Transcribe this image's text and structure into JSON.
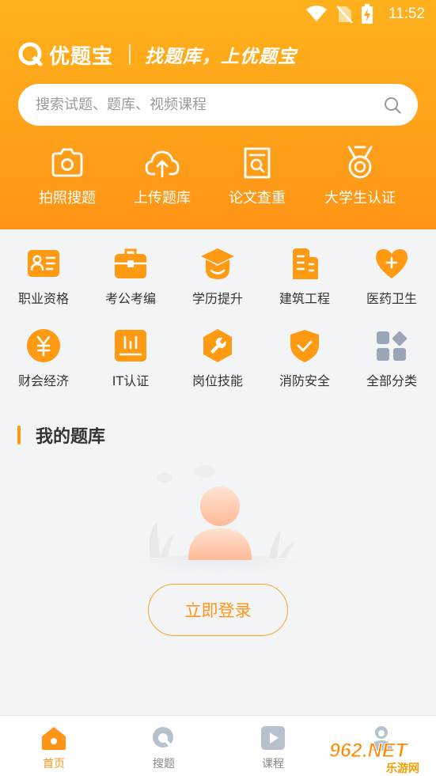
{
  "status": {
    "time": "11:52"
  },
  "brand": {
    "name": "优题宝",
    "slogan": "找题库，上优题宝"
  },
  "search": {
    "placeholder": "搜索试题、题库、视频课程"
  },
  "quick_actions": [
    {
      "label": "拍照搜题",
      "icon": "camera-icon"
    },
    {
      "label": "上传题库",
      "icon": "cloud-upload-icon"
    },
    {
      "label": "论文查重",
      "icon": "document-search-icon"
    },
    {
      "label": "大学生认证",
      "icon": "medal-icon"
    }
  ],
  "categories": [
    {
      "label": "职业资格",
      "icon": "id-card-icon"
    },
    {
      "label": "考公考编",
      "icon": "briefcase-icon"
    },
    {
      "label": "学历提升",
      "icon": "graduation-cap-icon"
    },
    {
      "label": "建筑工程",
      "icon": "building-icon"
    },
    {
      "label": "医药卫生",
      "icon": "heart-plus-icon"
    },
    {
      "label": "财会经济",
      "icon": "yuan-icon"
    },
    {
      "label": "IT认证",
      "icon": "monitor-icon"
    },
    {
      "label": "岗位技能",
      "icon": "wrench-icon"
    },
    {
      "label": "消防安全",
      "icon": "shield-check-icon"
    },
    {
      "label": "全部分类",
      "icon": "grid-icon"
    }
  ],
  "my_bank": {
    "title": "我的题库",
    "login_label": "立即登录"
  },
  "bottom_nav": [
    {
      "label": "首页",
      "icon": "home-icon",
      "active": true
    },
    {
      "label": "搜题",
      "icon": "search-logo-icon",
      "active": false
    },
    {
      "label": "课程",
      "icon": "play-icon",
      "active": false
    },
    {
      "label": "",
      "icon": "profile-icon",
      "active": false
    }
  ],
  "watermark": {
    "text": "962.NET",
    "subtext": "乐游网"
  },
  "colors": {
    "accent": "#ff9416",
    "header_top": "#ffb11c",
    "category_icon": "#ff9a12",
    "all_icon": "#9aa5b8"
  }
}
